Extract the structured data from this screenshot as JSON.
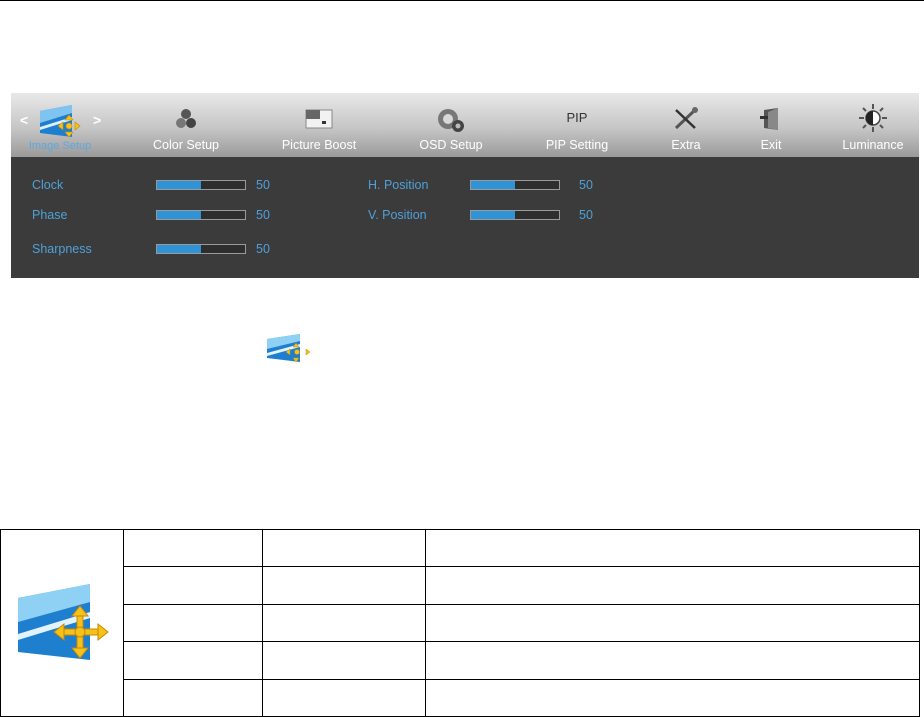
{
  "osd": {
    "menu": [
      {
        "label": "Image Setup",
        "icon": "image-setup-icon",
        "active": true
      },
      {
        "label": "Color Setup",
        "icon": "color-setup-icon",
        "active": false
      },
      {
        "label": "Picture Boost",
        "icon": "picture-boost-icon",
        "active": false
      },
      {
        "label": "OSD Setup",
        "icon": "osd-setup-icon",
        "active": false
      },
      {
        "label": "PIP Setting",
        "icon": "pip-icon",
        "icon_text": "PIP",
        "active": false
      },
      {
        "label": "Extra",
        "icon": "extra-tools-icon",
        "active": false
      },
      {
        "label": "Exit",
        "icon": "exit-door-icon",
        "active": false
      },
      {
        "label": "Luminance",
        "icon": "luminance-sun-icon",
        "active": false
      }
    ],
    "nav_left": "<",
    "nav_right": ">",
    "params_left": [
      {
        "name": "Clock",
        "value": "50",
        "level": 0.5
      },
      {
        "name": "Phase",
        "value": "50",
        "level": 0.5
      },
      {
        "name": "Sharpness",
        "value": "50",
        "level": 0.5
      }
    ],
    "params_right": [
      {
        "name": "H. Position",
        "value": "50",
        "level": 0.5
      },
      {
        "name": "V. Position",
        "value": "50",
        "level": 0.5
      }
    ],
    "colors": {
      "accent": "#2f93d6",
      "label_blue": "#4fa0d8",
      "panel": "#3b3b3b"
    }
  },
  "table": {
    "rows": 5,
    "icon": "image-setup-icon"
  }
}
